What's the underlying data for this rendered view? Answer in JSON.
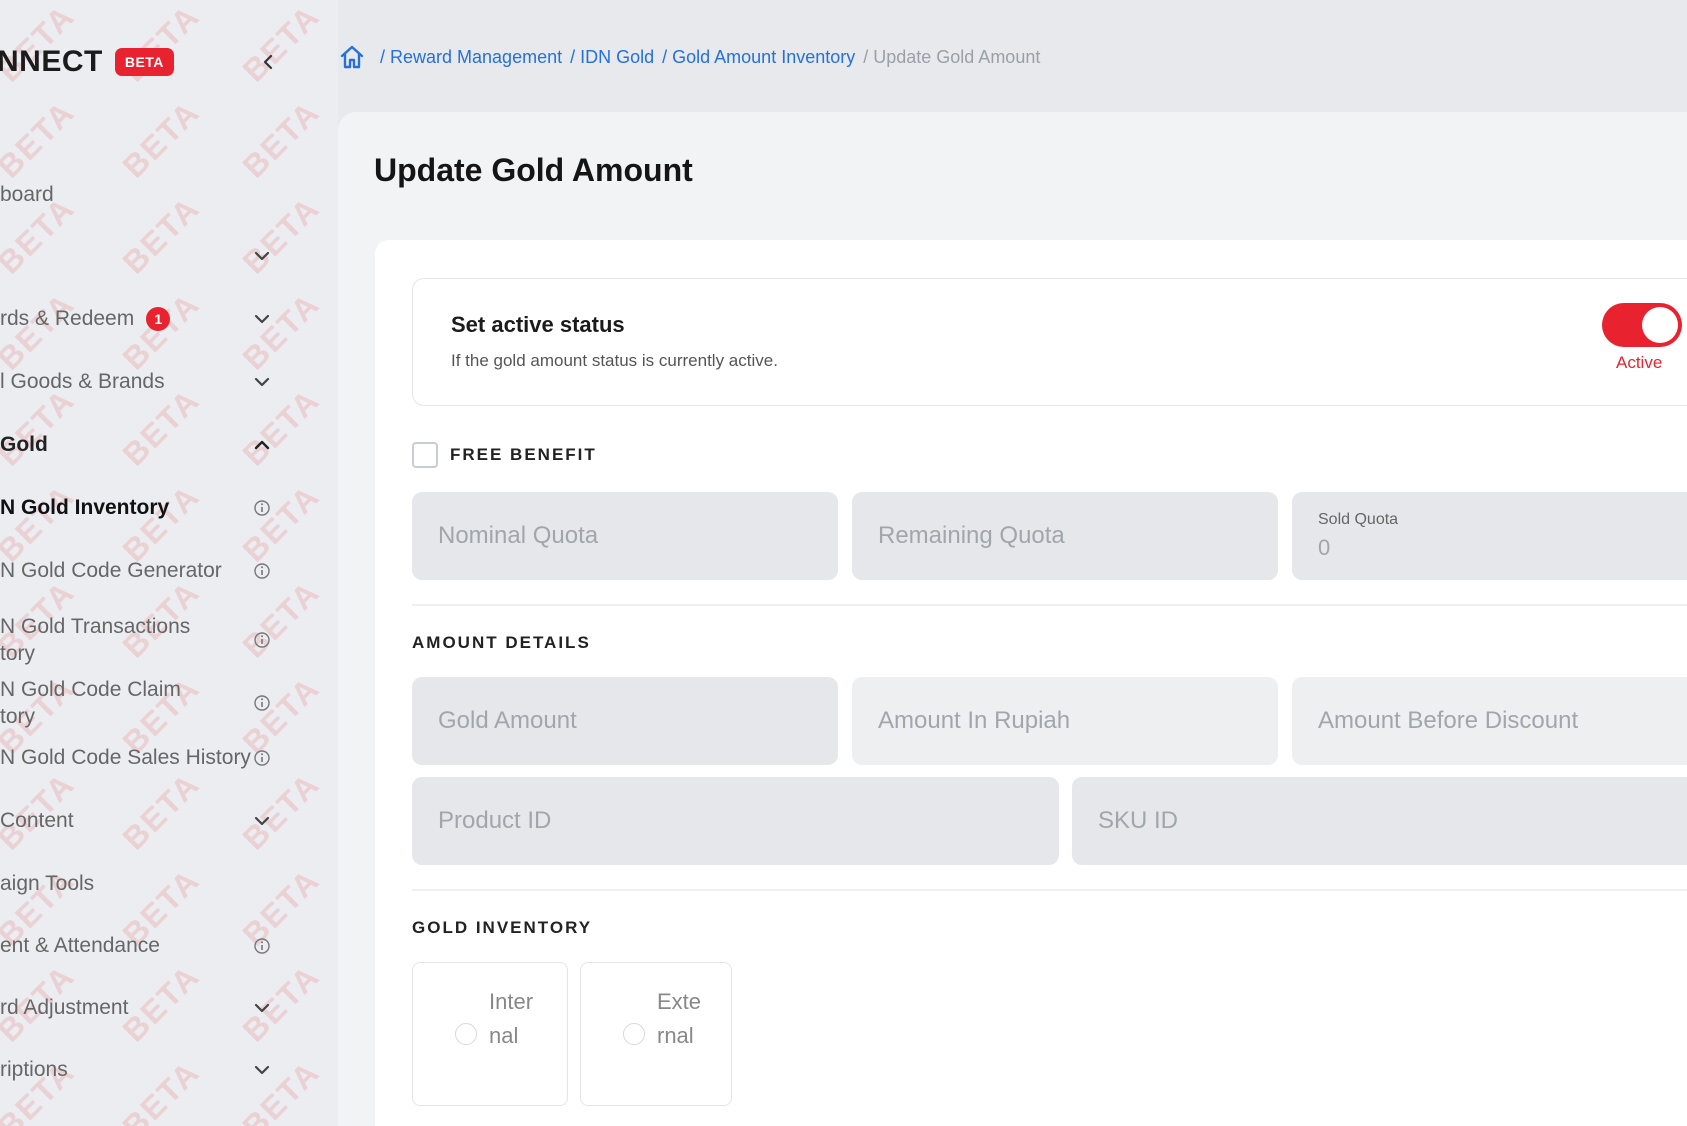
{
  "brand": {
    "name": "NNECT",
    "badge": "BETA"
  },
  "watermark_text": "BETA",
  "sidebar": {
    "items": [
      {
        "label": "board",
        "type": "link"
      },
      {
        "label": "",
        "type": "expand"
      },
      {
        "label": "rds & Redeem",
        "type": "expand",
        "badge": "1"
      },
      {
        "label": "l Goods & Brands",
        "type": "expand"
      },
      {
        "label": "Gold",
        "type": "section-open"
      },
      {
        "label": "N Gold Inventory",
        "type": "active-info"
      },
      {
        "label": "N Gold Code Generator",
        "type": "info"
      },
      {
        "label": "N Gold Transactions\ntory",
        "type": "info"
      },
      {
        "label": "N Gold Code Claim\ntory",
        "type": "info"
      },
      {
        "label": "N Gold Code Sales History",
        "type": "info"
      },
      {
        "label": "Content",
        "type": "expand"
      },
      {
        "label": "aign Tools",
        "type": "link"
      },
      {
        "label": "ent & Attendance",
        "type": "info"
      },
      {
        "label": "rd Adjustment",
        "type": "expand"
      },
      {
        "label": "riptions",
        "type": "expand"
      }
    ]
  },
  "breadcrumb": {
    "items": [
      "/ Reward Management",
      "/ IDN Gold",
      "/ Gold Amount Inventory"
    ],
    "current": "/ Update Gold Amount"
  },
  "page": {
    "title": "Update Gold Amount"
  },
  "status_section": {
    "title": "Set active status",
    "description": "If the gold amount status is currently active.",
    "toggle_label": "Active",
    "toggle_on": true
  },
  "free_benefit": {
    "label": "FREE BENEFIT",
    "checked": false
  },
  "quota_fields": {
    "nominal_placeholder": "Nominal Quota",
    "remaining_placeholder": "Remaining Quota",
    "sold_label": "Sold Quota",
    "sold_value": "0"
  },
  "amount_details": {
    "heading": "AMOUNT DETAILS",
    "gold_amount_placeholder": "Gold Amount",
    "amount_rupiah_placeholder": "Amount In Rupiah",
    "amount_before_discount_placeholder": "Amount Before Discount",
    "product_id_placeholder": "Product ID",
    "sku_id_placeholder": "SKU ID"
  },
  "gold_inventory": {
    "heading": "GOLD INVENTORY",
    "options": [
      "Internal",
      "External"
    ]
  },
  "colors": {
    "accent": "#e8222e",
    "link": "#2670d9"
  }
}
